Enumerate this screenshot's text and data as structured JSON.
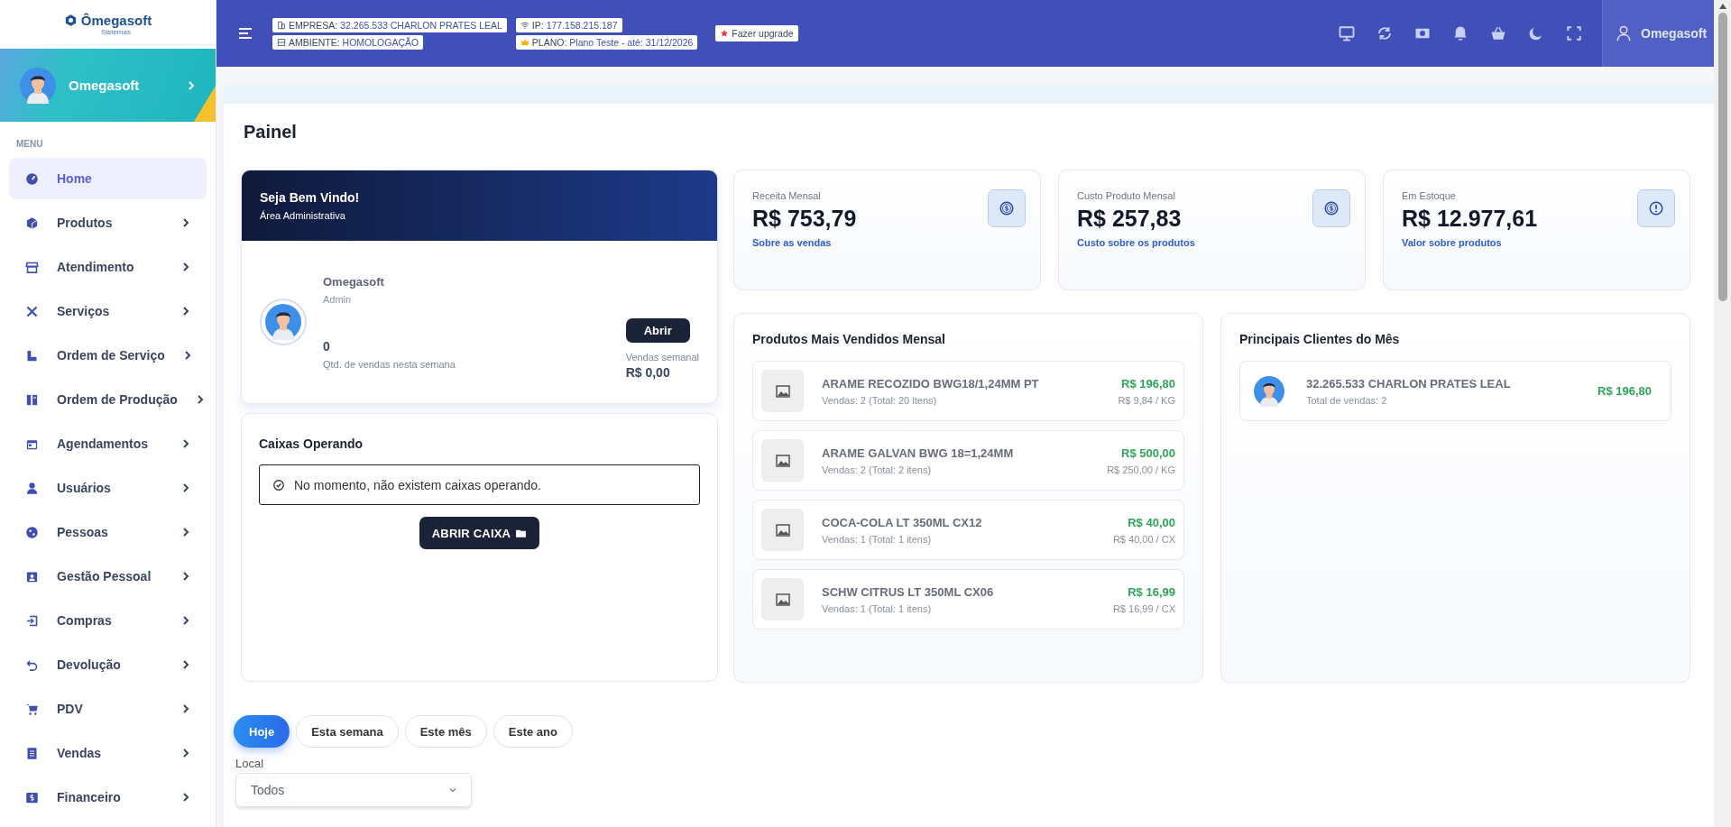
{
  "logo": {
    "name": "Ômegasoft",
    "tagline": "Sistemas"
  },
  "sidebar": {
    "user": "Omegasoft",
    "section": "MENU",
    "items": [
      {
        "label": "Home",
        "selected": true,
        "expandable": false
      },
      {
        "label": "Produtos",
        "selected": false,
        "expandable": true
      },
      {
        "label": "Atendimento",
        "selected": false,
        "expandable": true
      },
      {
        "label": "Serviços",
        "selected": false,
        "expandable": true
      },
      {
        "label": "Ordem de Serviço",
        "selected": false,
        "expandable": true
      },
      {
        "label": "Ordem de Produção",
        "selected": false,
        "expandable": true
      },
      {
        "label": "Agendamentos",
        "selected": false,
        "expandable": true
      },
      {
        "label": "Usuários",
        "selected": false,
        "expandable": true
      },
      {
        "label": "Pessoas",
        "selected": false,
        "expandable": true
      },
      {
        "label": "Gestão Pessoal",
        "selected": false,
        "expandable": true
      },
      {
        "label": "Compras",
        "selected": false,
        "expandable": true
      },
      {
        "label": "Devolução",
        "selected": false,
        "expandable": true
      },
      {
        "label": "PDV",
        "selected": false,
        "expandable": true
      },
      {
        "label": "Vendas",
        "selected": false,
        "expandable": true
      },
      {
        "label": "Financeiro",
        "selected": false,
        "expandable": true
      }
    ]
  },
  "topbar": {
    "badges": [
      {
        "label": "EMPRESA:",
        "value": "32.265.533 CHARLON PRATES LEAL"
      },
      {
        "label": "AMBIENTE:",
        "value": "HOMOLOGAÇÃO"
      },
      {
        "label": "IP:",
        "value": "177.158.215.187"
      },
      {
        "label": "PLANO:",
        "value": "Plano Teste - até: 31/12/2026"
      }
    ],
    "upgrade": "Fazer upgrade",
    "user": "Omegasoft"
  },
  "page": {
    "title": "Painel"
  },
  "welcome": {
    "title": "Seja Bem Vindo!",
    "subtitle": "Área Administrativa",
    "user": "Omegasoft",
    "role": "Admin",
    "count": "0",
    "count_label": "Qtd. de vendas nesta semana",
    "button": "Abrir",
    "weekly_label": "Vendas semanal",
    "weekly_value": "R$ 0,00"
  },
  "stats": [
    {
      "label": "Receita Mensal",
      "value": "R$ 753,79",
      "link": "Sobre as vendas",
      "kind": "money"
    },
    {
      "label": "Custo Produto Mensal",
      "value": "R$ 257,83",
      "link": "Custo sobre os produtos",
      "kind": "money"
    },
    {
      "label": "Em Estoque",
      "value": "R$ 12.977,61",
      "link": "Valor sobre produtos",
      "kind": "alert"
    }
  ],
  "top_products": {
    "title": "Produtos Mais Vendidos Mensal",
    "items": [
      {
        "name": "ARAME RECOZIDO BWG18/1,24MM PT",
        "sales": "Vendas: 2 (Total: 20 itens)",
        "total": "R$ 196,80",
        "unit": "R$ 9,84 / KG"
      },
      {
        "name": "ARAME GALVAN BWG 18=1,24MM",
        "sales": "Vendas: 2 (Total: 2 itens)",
        "total": "R$ 500,00",
        "unit": "R$ 250,00 / KG"
      },
      {
        "name": "COCA-COLA LT 350ML CX12",
        "sales": "Vendas: 1 (Total: 1 itens)",
        "total": "R$ 40,00",
        "unit": "R$ 40,00 / CX"
      },
      {
        "name": "SCHW CITRUS LT 350ML CX06",
        "sales": "Vendas: 1 (Total: 1 itens)",
        "total": "R$ 16,99",
        "unit": "R$ 16,99 / CX"
      }
    ]
  },
  "top_clients": {
    "title": "Principais Clientes do Mês",
    "items": [
      {
        "name": "32.265.533 CHARLON PRATES LEAL",
        "sales": "Total de vendas: 2",
        "total": "R$ 196,80"
      }
    ]
  },
  "cash_registers": {
    "title": "Caixas Operando",
    "message": "No momento, não existem caixas operando.",
    "button": "ABRIR CAIXA"
  },
  "filters": [
    {
      "label": "Hoje",
      "selected": true
    },
    {
      "label": "Esta semana",
      "selected": false
    },
    {
      "label": "Este mês",
      "selected": false
    },
    {
      "label": "Este ano",
      "selected": false
    }
  ],
  "location": {
    "label": "Local",
    "value": "Todos"
  }
}
